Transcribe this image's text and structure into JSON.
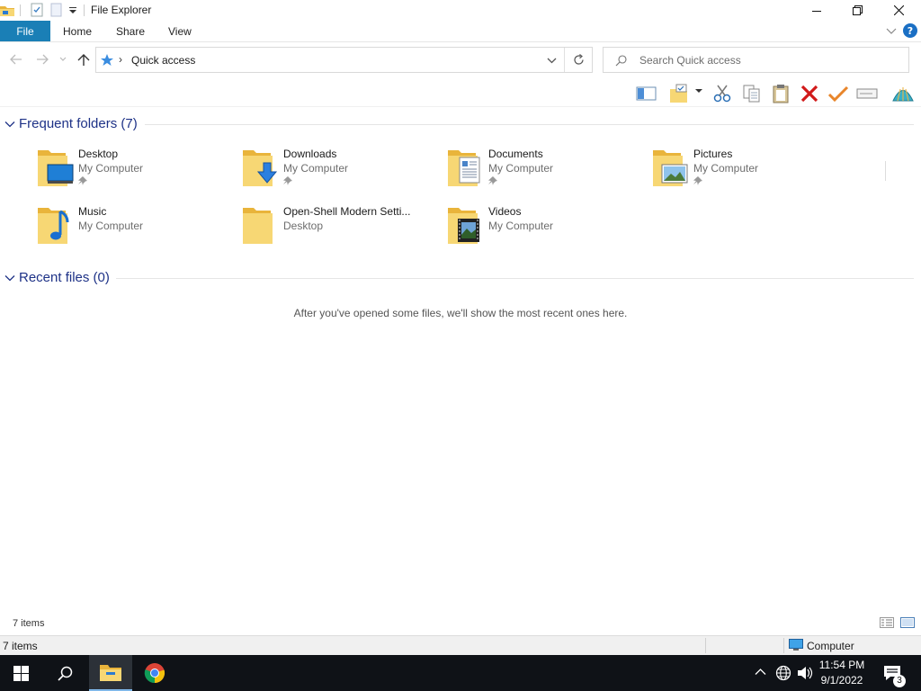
{
  "window": {
    "title": "File Explorer",
    "qat": [
      "folder-icon",
      "properties-icon",
      "new-folder-icon",
      "customize-dropdown-icon"
    ],
    "controls": [
      "minimize-icon",
      "restore-icon",
      "close-icon"
    ]
  },
  "ribbon": {
    "tabs": [
      "File",
      "Home",
      "Share",
      "View"
    ]
  },
  "address": {
    "path": "Quick access",
    "search_placeholder": "Search Quick access"
  },
  "groups": {
    "frequent": {
      "title": "Frequent folders (7)",
      "items": [
        {
          "name": "Desktop",
          "location": "My Computer",
          "pinned": true,
          "icon": "desktop-folder-icon"
        },
        {
          "name": "Downloads",
          "location": "My Computer",
          "pinned": true,
          "icon": "downloads-folder-icon"
        },
        {
          "name": "Documents",
          "location": "My Computer",
          "pinned": true,
          "icon": "documents-folder-icon"
        },
        {
          "name": "Pictures",
          "location": "My Computer",
          "pinned": true,
          "icon": "pictures-folder-icon"
        },
        {
          "name": "Music",
          "location": "My Computer",
          "pinned": false,
          "icon": "music-folder-icon"
        },
        {
          "name": "Open-Shell Modern Setti...",
          "location": "Desktop",
          "pinned": false,
          "icon": "folder-icon"
        },
        {
          "name": "Videos",
          "location": "My Computer",
          "pinned": false,
          "icon": "videos-folder-icon"
        }
      ]
    },
    "recent": {
      "title": "Recent files (0)",
      "empty_message": "After you've opened some files, we'll show the most recent ones here."
    }
  },
  "status": {
    "items_count": "7 items",
    "bottom_left": "7 items",
    "bottom_right": "Computer"
  },
  "taskbar": {
    "time": "11:54 PM",
    "date": "9/1/2022",
    "notification_count": "3"
  },
  "colors": {
    "file_tab": "#1a7fb6",
    "group_header": "#1e3287",
    "taskbar": "#0f1217",
    "folder_yellow": "#f7d774"
  }
}
